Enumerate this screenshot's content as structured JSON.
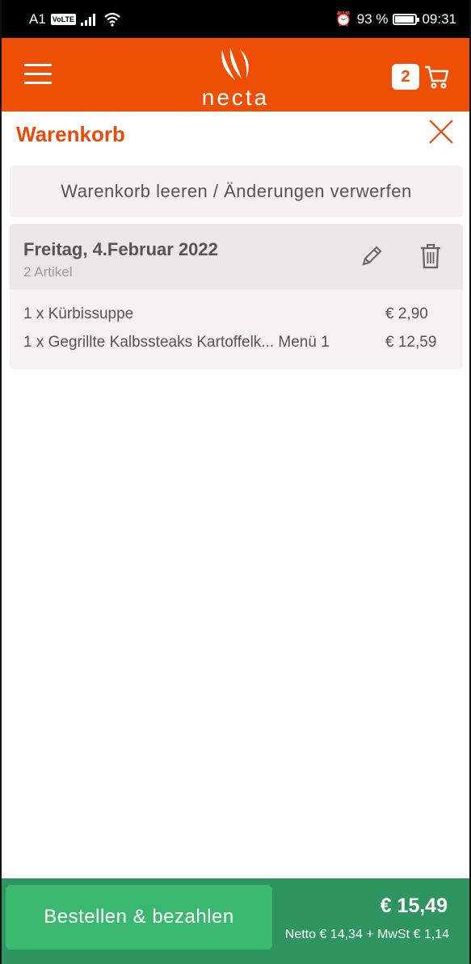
{
  "status_bar": {
    "carrier": "A1",
    "volte": "VoLTE",
    "alarm": "⏰",
    "battery_percent": "93 %",
    "battery_level": 0.93,
    "time": "09:31"
  },
  "app_bar": {
    "logo_text": "necta",
    "cart_count": "2"
  },
  "page": {
    "title": "Warenkorb"
  },
  "clear_button": {
    "label": "Warenkorb leeren / Änderungen verwerfen"
  },
  "order": {
    "date": "Freitag, 4.Februar 2022",
    "article_count": "2 Artikel",
    "items": [
      {
        "text": "1 x Kürbissuppe",
        "price": "€ 2,90"
      },
      {
        "text": "1 x Gegrillte Kalbssteaks Kartoffelk... Menü 1",
        "price": "€ 12,59"
      }
    ]
  },
  "footer": {
    "pay_label": "Bestellen & bezahlen",
    "total": "€ 15,49",
    "netto": "Netto € 14,34 + MwSt € 1,14"
  },
  "colors": {
    "brand_orange": "#ee4f05",
    "title_orange": "#e84b0c",
    "footer_green": "#2e9560",
    "button_green": "#3bb870"
  }
}
